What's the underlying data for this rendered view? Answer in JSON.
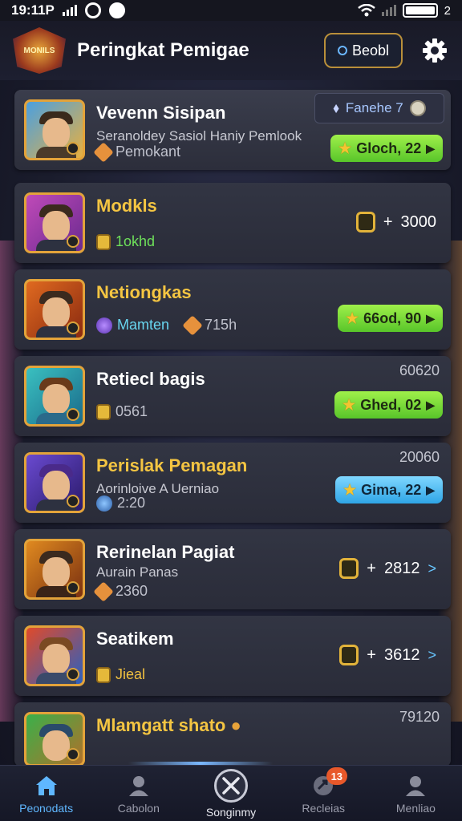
{
  "status": {
    "time": "19:11P",
    "battery": "2"
  },
  "header": {
    "logo_text": "MONILS",
    "title": "Peringkat Pemigae",
    "button_label": "Beobl"
  },
  "rank_chip": {
    "label": "Fanehe 7"
  },
  "players": [
    {
      "name": "Vevenn Sisipan",
      "sub": "Seranoldey Sasiol Haniy Pemlook",
      "meta": "Pemokant",
      "badge": "Gloch, 22",
      "badge_type": "green"
    },
    {
      "name": "Modkls",
      "meta": "1okhd",
      "score": "3000"
    },
    {
      "name": "Netiongkas",
      "meta1": "Mamten",
      "meta2": "715h",
      "badge": "66od, 90",
      "badge_type": "green"
    },
    {
      "name": "Retiecl bagis",
      "meta": "0561",
      "top_value": "60620",
      "badge": "Ghed, 02",
      "badge_type": "green"
    },
    {
      "name": "Perislak Pemagan",
      "sub": "Aorinloive A Uerniao",
      "meta": "2:20",
      "top_value": "20060",
      "badge": "Gima, 22",
      "badge_type": "blue"
    },
    {
      "name": "Rerinelan Pagiat",
      "sub": "Aurain Panas",
      "meta": "2360",
      "score": "2812"
    },
    {
      "name": "Seatikem",
      "meta": "Jieal",
      "score": "3612"
    },
    {
      "name": "Mlamgatt shato",
      "top_value": "79120"
    }
  ],
  "nav": [
    {
      "label": "Peonodats",
      "icon": "home-icon"
    },
    {
      "label": "Cabolon",
      "icon": "user-icon"
    },
    {
      "label": "Songinmy",
      "icon": "crossed-swords-icon"
    },
    {
      "label": "Recleias",
      "icon": "rocket-icon",
      "badge": "13"
    },
    {
      "label": "Menliao",
      "icon": "profile-icon"
    }
  ],
  "colors": {
    "accent_gold": "#e3a33a",
    "pill_green": "#6fd936",
    "pill_blue": "#4cbcf3",
    "active_nav": "#5fb7ff"
  }
}
